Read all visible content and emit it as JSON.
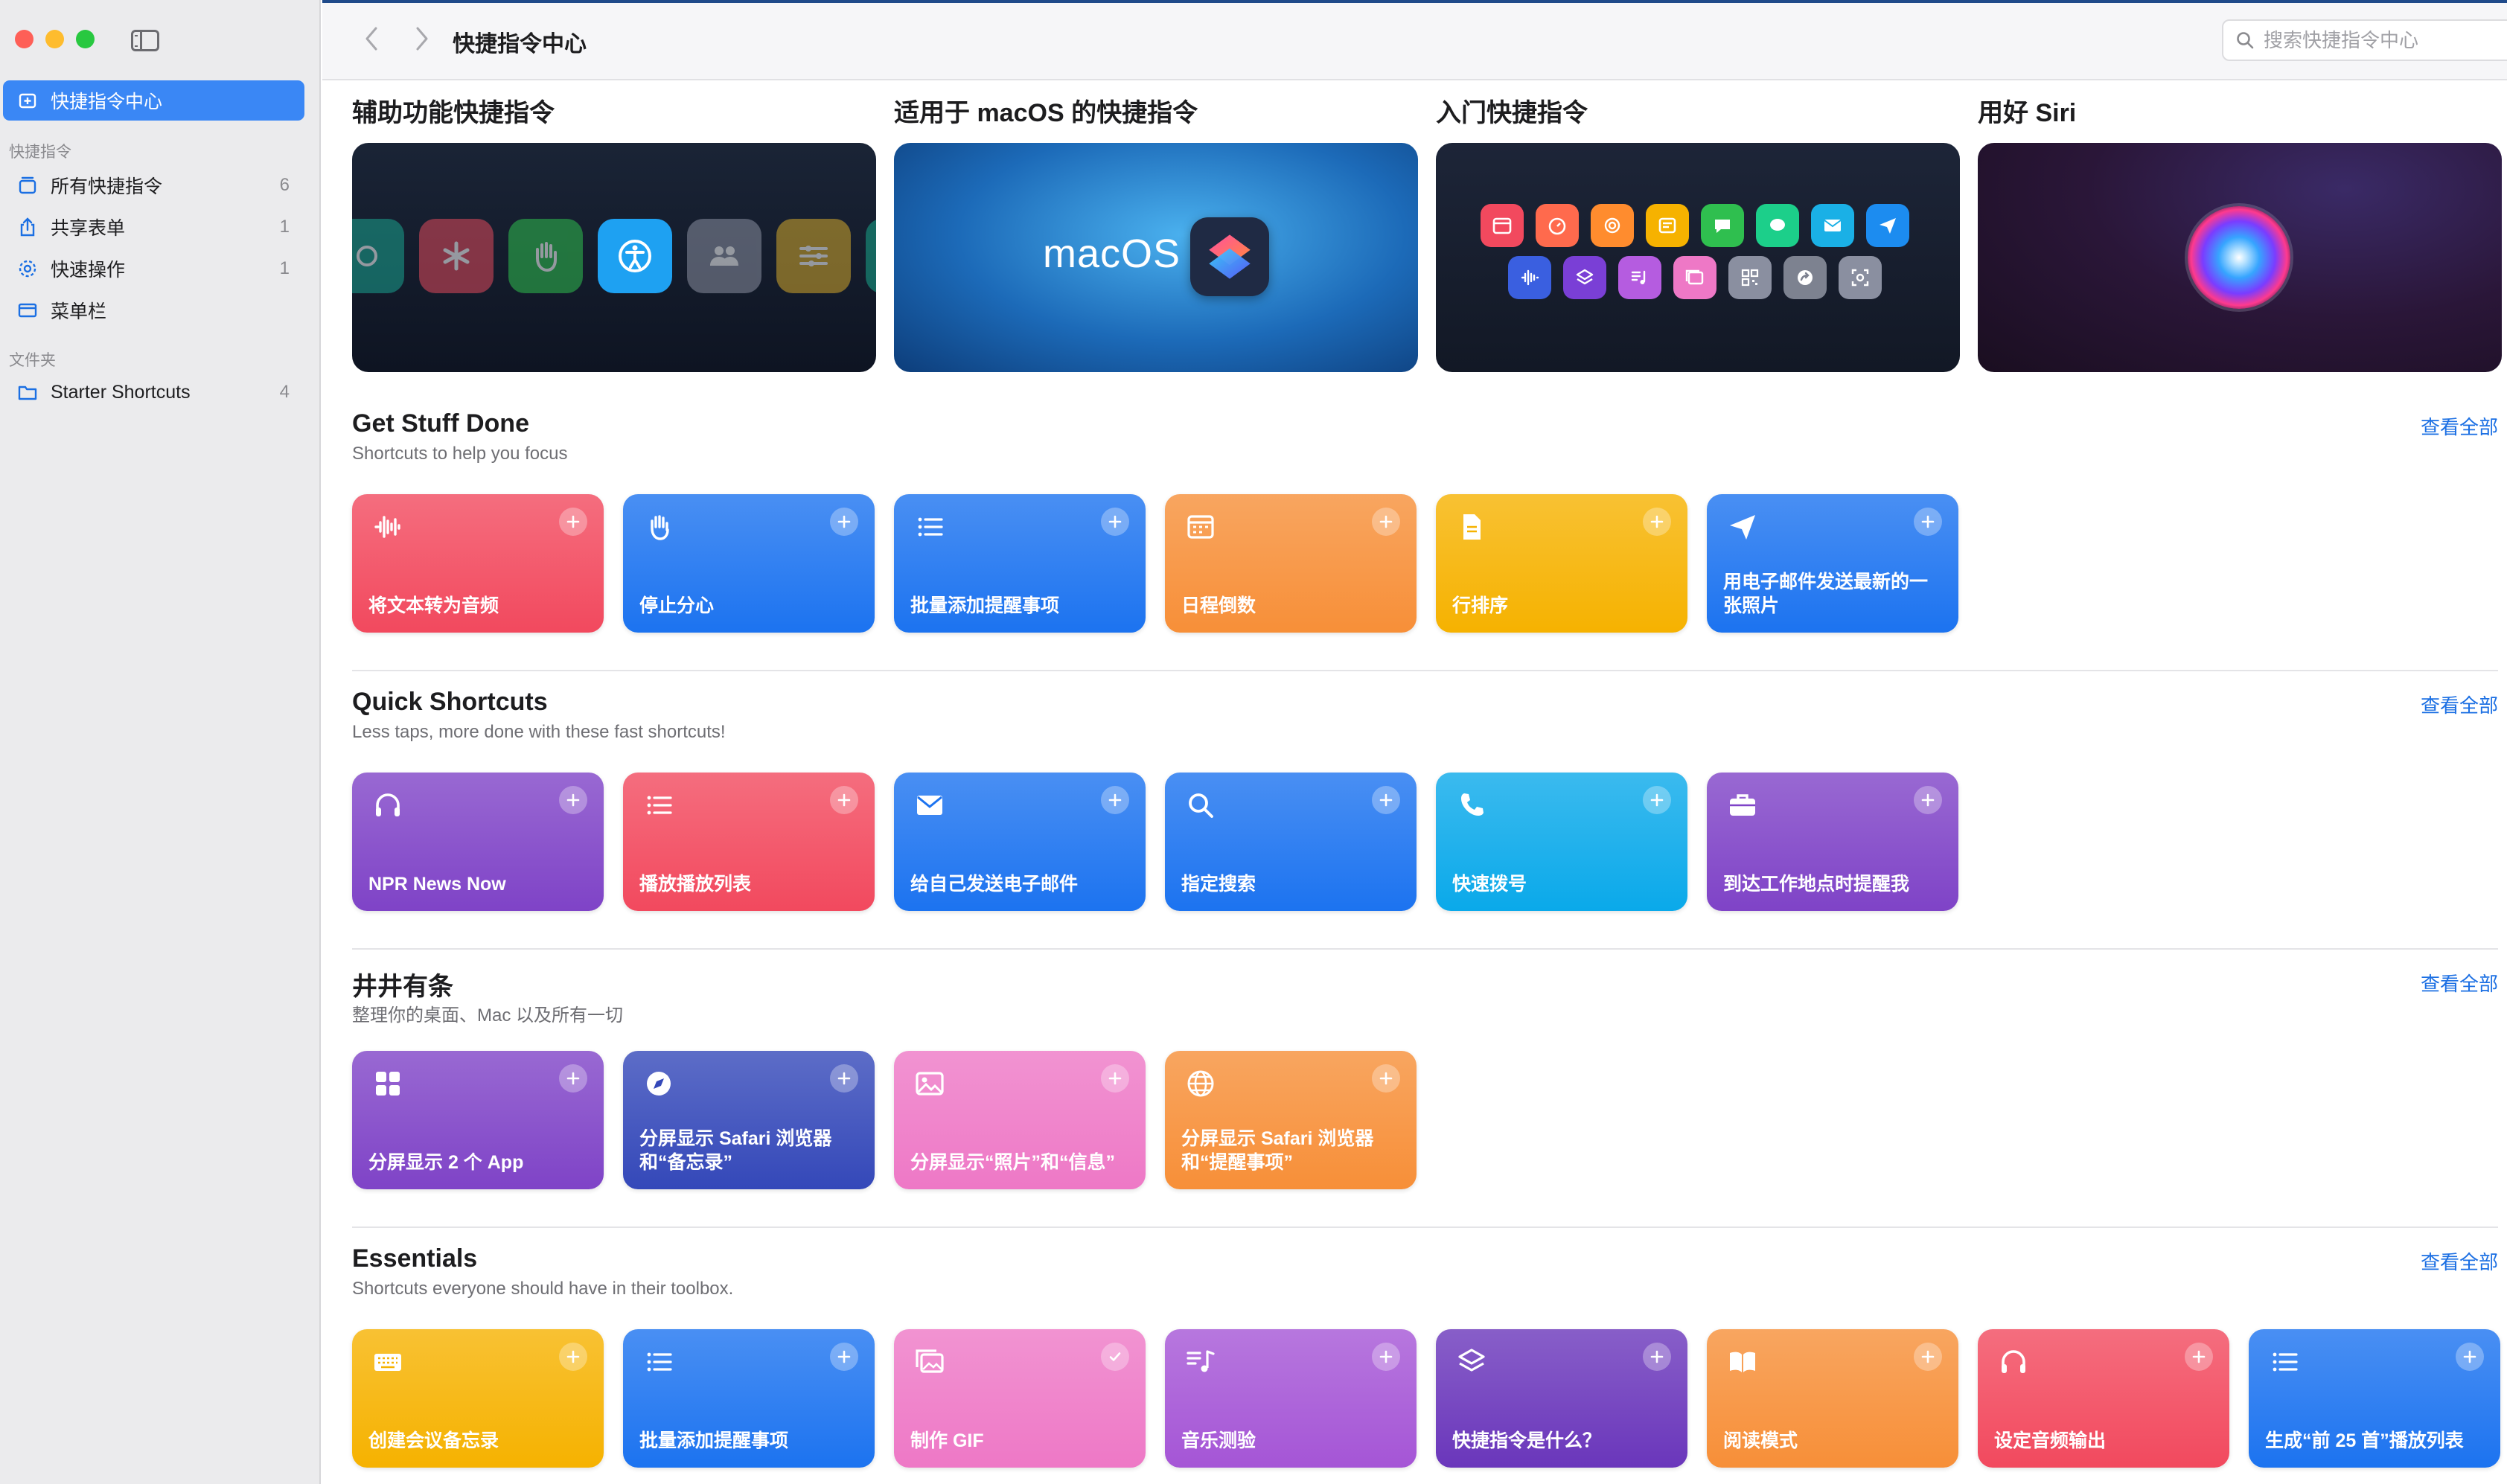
{
  "toolbar": {
    "title": "快捷指令中心",
    "search_placeholder": "搜索快捷指令中心"
  },
  "sidebar": {
    "gallery_label": "快捷指令中心",
    "section_shortcuts": "快捷指令",
    "items": [
      {
        "label": "所有快捷指令",
        "count": "6"
      },
      {
        "label": "共享表单",
        "count": "1"
      },
      {
        "label": "快速操作",
        "count": "1"
      },
      {
        "label": "菜单栏",
        "count": ""
      }
    ],
    "section_folders": "文件夹",
    "folders": [
      {
        "label": "Starter Shortcuts",
        "count": "4"
      }
    ]
  },
  "featured": [
    {
      "title": "辅助功能快捷指令"
    },
    {
      "title": "适用于 macOS 的快捷指令",
      "banner_text": "macOS"
    },
    {
      "title": "入门快捷指令"
    },
    {
      "title": "用好 Siri"
    }
  ],
  "see_all": "查看全部",
  "sections": [
    {
      "title": "Get Stuff Done",
      "subtitle": "Shortcuts to help you focus",
      "cards": [
        {
          "label": "将文本转为音频",
          "icon": "waveform-icon",
          "color": "#f2495e"
        },
        {
          "label": "停止分心",
          "icon": "hand-icon",
          "color": "#1c73f0"
        },
        {
          "label": "批量添加提醒事项",
          "icon": "list-icon",
          "color": "#1c73f0"
        },
        {
          "label": "日程倒数",
          "icon": "calendar-icon",
          "color": "#f78f38"
        },
        {
          "label": "行排序",
          "icon": "document-icon",
          "color": "#f6b200"
        },
        {
          "label": "用电子邮件发送最新的一张照片",
          "icon": "paperplane-icon",
          "color": "#1c73f0"
        }
      ]
    },
    {
      "title": "Quick Shortcuts",
      "subtitle": "Less taps, more done with these fast shortcuts!",
      "cards": [
        {
          "label": "NPR News Now",
          "icon": "headphones-icon",
          "color": "#7f43c7"
        },
        {
          "label": "播放播放列表",
          "icon": "list-icon",
          "color": "#f2495e"
        },
        {
          "label": "给自己发送电子邮件",
          "icon": "envelope-icon",
          "color": "#1c73f0"
        },
        {
          "label": "指定搜索",
          "icon": "magnifier-icon",
          "color": "#1c73f0"
        },
        {
          "label": "快速拨号",
          "icon": "phone-icon",
          "color": "#0aa9ea"
        },
        {
          "label": "到达工作地点时提醒我",
          "icon": "briefcase-icon",
          "color": "#7f43c7"
        }
      ]
    },
    {
      "title": "井井有条",
      "subtitle": "整理你的桌面、Mac 以及所有一切",
      "cards": [
        {
          "label": "分屏显示 2 个 App",
          "icon": "grid-icon",
          "color": "#7f43c7"
        },
        {
          "label": "分屏显示 Safari 浏览器和“备忘录”",
          "icon": "compass-icon",
          "color": "#3448b9"
        },
        {
          "label": "分屏显示“照片”和“信息”",
          "icon": "photo-icon",
          "color": "#ee78c6"
        },
        {
          "label": "分屏显示 Safari 浏览器和“提醒事项”",
          "icon": "globe-icon",
          "color": "#f78f38"
        }
      ]
    },
    {
      "title": "Essentials",
      "subtitle": "Shortcuts everyone should have in their toolbox.",
      "cards": [
        {
          "label": "创建会议备忘录",
          "icon": "keyboard-icon",
          "color": "#f6b200"
        },
        {
          "label": "批量添加提醒事项",
          "icon": "list-icon",
          "color": "#1c73f0"
        },
        {
          "label": "制作 GIF",
          "icon": "photos-stack-icon",
          "color": "#ee78c6",
          "added": true
        },
        {
          "label": "音乐测验",
          "icon": "music-list-icon",
          "color": "#a555d6"
        },
        {
          "label": "快捷指令是什么？",
          "icon": "layers-icon",
          "color": "#6a36bb"
        },
        {
          "label": "阅读模式",
          "icon": "book-icon",
          "color": "#f78f38"
        },
        {
          "label": "设定音频输出",
          "icon": "headphones-icon",
          "color": "#f2495e"
        },
        {
          "label": "生成“前 25 首”播放列表",
          "icon": "list-icon",
          "color": "#1c73f0"
        }
      ]
    }
  ]
}
